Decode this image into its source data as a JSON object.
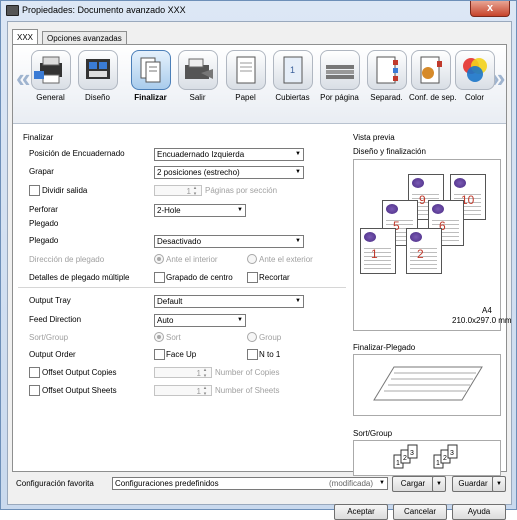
{
  "window": {
    "title": "Propiedades: Documento avanzado XXX",
    "close": "x"
  },
  "tabs": [
    {
      "label": "XXX"
    },
    {
      "label": "Opciones avanzadas"
    }
  ],
  "nav": [
    {
      "label": "General",
      "icon": "printer-icon"
    },
    {
      "label": "Diseño",
      "icon": "layout-icon"
    },
    {
      "label": "Finalizar",
      "icon": "finishing-icon"
    },
    {
      "label": "Salir",
      "icon": "output-tray-icon"
    },
    {
      "label": "Papel",
      "icon": "paper-icon"
    },
    {
      "label": "Cubiertas",
      "icon": "cover-icon"
    },
    {
      "label": "Por página",
      "icon": "per-page-icon"
    },
    {
      "label": "Separad.",
      "icon": "separator-icon"
    },
    {
      "label": "Conf. de sep.",
      "icon": "separator-settings-icon"
    },
    {
      "label": "Color",
      "icon": "color-icon"
    }
  ],
  "arrows": {
    "left": "«",
    "right": "»"
  },
  "finalizar": {
    "section": "Finalizar",
    "posicion": {
      "label": "Posición de Encuadernado",
      "value": "Encuadernado Izquierda"
    },
    "grapar": {
      "label": "Grapar",
      "value": "2 posiciones (estrecho)"
    },
    "dividir": {
      "label": "Dividir salida",
      "spin": "1",
      "unit": "Páginas por sección"
    },
    "perforar": {
      "label": "Perforar",
      "value": "2-Hole"
    },
    "plegado_section": "Plegado",
    "plegado": {
      "label": "Plegado",
      "value": "Desactivado"
    },
    "direccion": {
      "label": "Dirección de plegado",
      "opt1": "Ante el interior",
      "opt2": "Ante el exterior"
    },
    "detalles": {
      "label": "Detalles de plegado múltiple",
      "opt1": "Grapado de centro",
      "opt2": "Recortar"
    },
    "output_tray": {
      "label": "Output Tray",
      "value": "Default"
    },
    "feed_direction": {
      "label": "Feed Direction",
      "value": "Auto"
    },
    "sort_group": {
      "label": "Sort/Group",
      "opt1": "Sort",
      "opt2": "Group"
    },
    "output_order": {
      "label": "Output Order",
      "opt1": "Face Up",
      "opt2": "N to 1"
    },
    "offset_copies": {
      "label": "Offset Output Copies",
      "spin": "1",
      "unit": "Number of Copies"
    },
    "offset_sheets": {
      "label": "Offset Output Sheets",
      "spin": "1",
      "unit": "Number of Sheets"
    }
  },
  "preview": {
    "section": "Vista previa",
    "design_label": "Diseño y finalización",
    "pages": [
      "9",
      "10",
      "5",
      "6",
      "1",
      "2"
    ],
    "paper": "A4",
    "size": "210.0x297.0 mm",
    "folding_label": "Finalizar-Plegado",
    "sort_label": "Sort/Group"
  },
  "footer": {
    "fav_label": "Configuración favorita",
    "fav_value": "Configuraciones predefinidos",
    "fav_modified": "(modificada)",
    "load": "Cargar",
    "save": "Guardar",
    "ok": "Aceptar",
    "cancel": "Cancelar",
    "help": "Ayuda"
  }
}
